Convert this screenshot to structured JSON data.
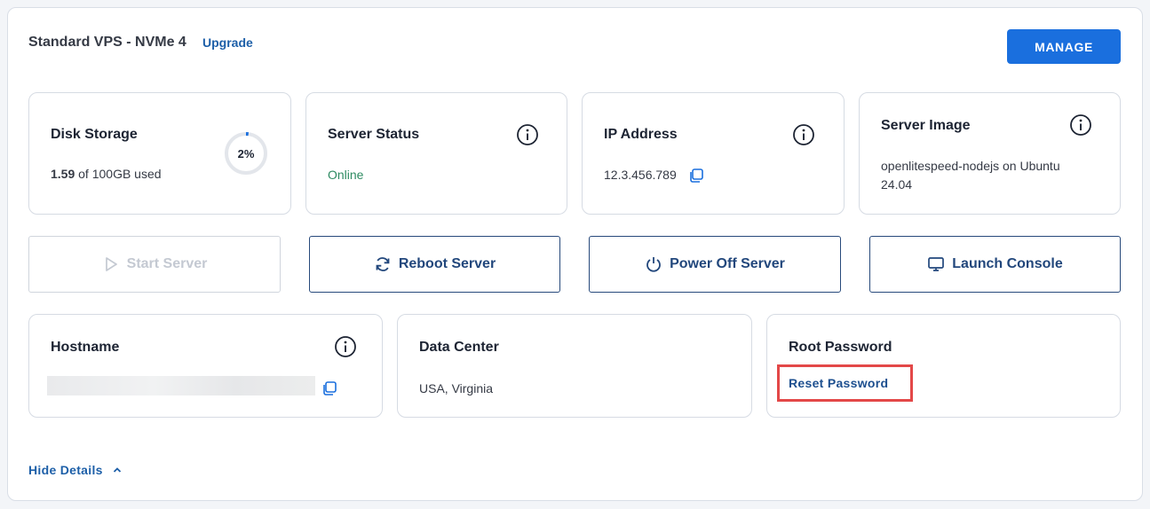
{
  "header": {
    "title": "Standard VPS - NVMe 4",
    "upgrade_label": "Upgrade",
    "manage_label": "MANAGE"
  },
  "disk_storage": {
    "title": "Disk Storage",
    "used_value": "1.59",
    "used_suffix": " of 100GB used",
    "percent_label": "2%",
    "percent_value": 2
  },
  "server_status": {
    "title": "Server Status",
    "status": "Online"
  },
  "ip_address": {
    "title": "IP Address",
    "value": "12.3.456.789"
  },
  "server_image": {
    "title": "Server Image",
    "line1": "openlitespeed-nodejs on Ubuntu",
    "line2": "24.04"
  },
  "actions": {
    "start": "Start Server",
    "reboot": "Reboot Server",
    "power_off": "Power Off Server",
    "console": "Launch Console"
  },
  "hostname": {
    "title": "Hostname"
  },
  "data_center": {
    "title": "Data Center",
    "value": "USA, Virginia"
  },
  "root_password": {
    "title": "Root Password",
    "reset_label": "Reset Password"
  },
  "footer": {
    "hide_details_label": "Hide Details"
  },
  "colors": {
    "accent": "#1a6fde",
    "link": "#1d5fa8",
    "online": "#2e8b62",
    "highlight": "#e34848"
  },
  "icons": [
    "info-icon",
    "copy-icon",
    "play-icon",
    "refresh-icon",
    "power-icon",
    "monitor-icon",
    "chevron-up-icon"
  ]
}
